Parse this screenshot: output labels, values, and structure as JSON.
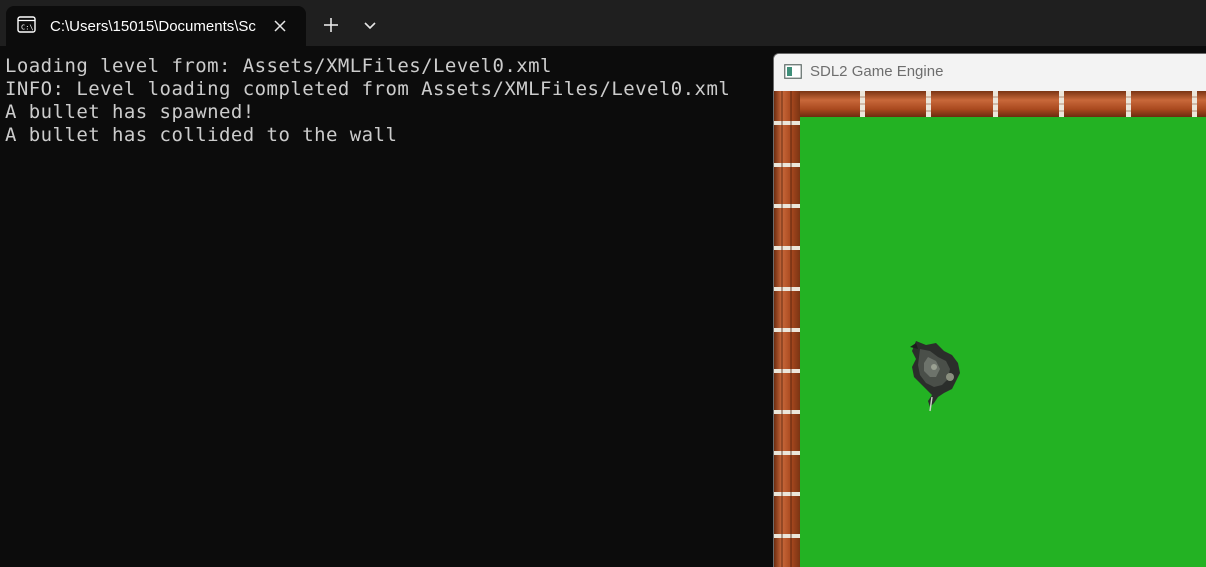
{
  "terminal": {
    "tab": {
      "title": "C:\\Users\\15015\\Documents\\Sc",
      "icon": "terminal-icon",
      "close_icon": "close-icon"
    },
    "new_tab_icon": "plus-icon",
    "dropdown_icon": "chevron-down-icon",
    "output": [
      "Loading level from: Assets/XMLFiles/Level0.xml",
      "INFO: Level loading completed from Assets/XMLFiles/Level0.xml",
      "A bullet has spawned!",
      "A bullet has collided to the wall"
    ],
    "colors": {
      "background": "#0c0c0c",
      "tabbar": "#1f1f1f",
      "text": "#cccccc"
    }
  },
  "game_window": {
    "title": "SDL2 Game Engine",
    "icon": "window-app-icon",
    "colors": {
      "grass": "#23b223",
      "brick": "#b5532a",
      "mortar": "#e8e2d6"
    }
  }
}
